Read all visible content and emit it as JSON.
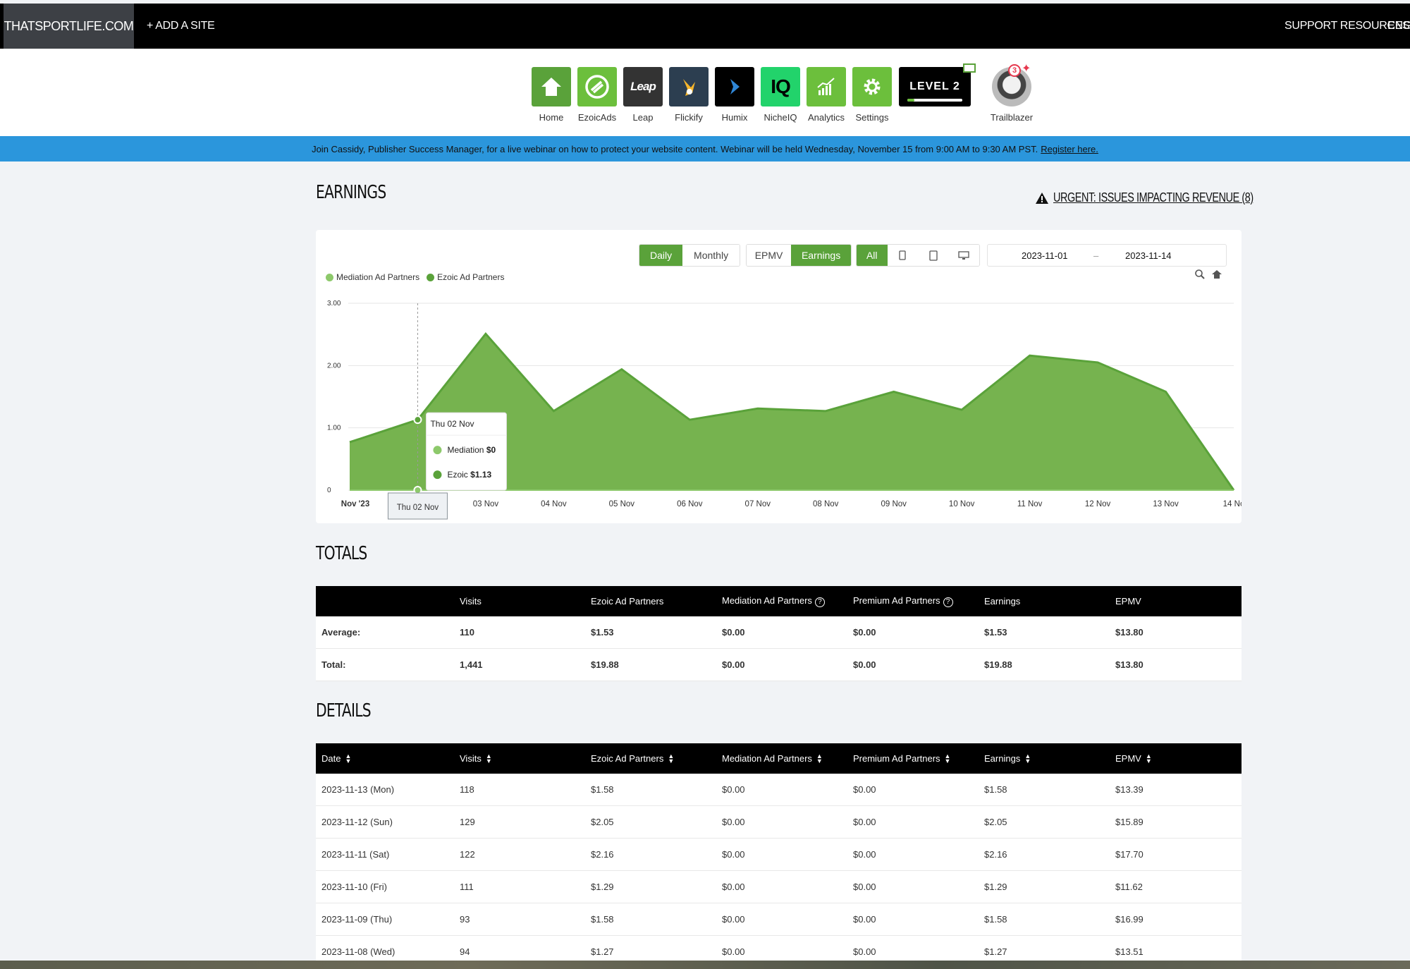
{
  "topbar": {
    "site": "THATSPORTLIFE.COM",
    "add_site": "+ ADD A SITE",
    "support": "SUPPORT RESOURCES",
    "language": "ENGLI"
  },
  "apps": [
    {
      "label": "Home",
      "icon": "home-icon",
      "color": "#5aa23a"
    },
    {
      "label": "EzoicAds",
      "icon": "ezoicads-icon",
      "color": "#6cbf3c"
    },
    {
      "label": "Leap",
      "icon": "leap-icon",
      "color": "#333333"
    },
    {
      "label": "Flickify",
      "icon": "flickify-icon",
      "color": "#2c3e50"
    },
    {
      "label": "Humix",
      "icon": "humix-icon",
      "color": "#000000"
    },
    {
      "label": "NicheIQ",
      "icon": "nicheiq-icon",
      "color": "#22d36b"
    },
    {
      "label": "Analytics",
      "icon": "analytics-icon",
      "color": "#6cbf3c"
    },
    {
      "label": "Settings",
      "icon": "gear-icon",
      "color": "#6cbf3c"
    }
  ],
  "level": {
    "text": "LEVEL 2"
  },
  "trailblazer": {
    "label": "Trailblazer",
    "badge": "3"
  },
  "banner": {
    "text": "Join Cassidy, Publisher Success Manager, for a live webinar on how to protect your website content. Webinar will be held Wednesday, November 15 from 9:00 AM to 9:30 AM PST.",
    "link": "Register here."
  },
  "earnings": {
    "title": "EARNINGS",
    "urgent": "URGENT: ISSUES IMPACTING REVENUE (8)",
    "period_buttons": [
      "Daily",
      "Monthly"
    ],
    "metric_buttons": [
      "EPMV",
      "Earnings"
    ],
    "device_all": "All",
    "date_from": "2023-11-01",
    "date_sep": "–",
    "date_to": "2023-11-14",
    "tooltip": {
      "date": "Thu 02 Nov",
      "mediation_label": "Mediation",
      "mediation_value": "$0",
      "ezoic_label": "Ezoic",
      "ezoic_value": "$1.13"
    },
    "crosshair_label": "Thu 02 Nov"
  },
  "chart_data": {
    "type": "area",
    "title": "",
    "xlabel": "",
    "ylabel": "",
    "x": [
      "Nov '23",
      "Thu 02 Nov",
      "03 Nov",
      "04 Nov",
      "05 Nov",
      "06 Nov",
      "07 Nov",
      "08 Nov",
      "09 Nov",
      "10 Nov",
      "11 Nov",
      "12 Nov",
      "13 Nov",
      "14 No"
    ],
    "ylim": [
      0,
      3
    ],
    "yticks": [
      "0",
      "1.00",
      "2.00",
      "3.00"
    ],
    "series": [
      {
        "name": "Mediation Ad Partners",
        "color": "#8dc96b",
        "values": [
          0,
          0,
          0,
          0,
          0,
          0,
          0,
          0,
          0,
          0,
          0,
          0,
          0,
          0
        ]
      },
      {
        "name": "Ezoic Ad Partners",
        "color": "#5aa23a",
        "values": [
          0.77,
          1.13,
          2.51,
          1.27,
          1.94,
          1.13,
          1.31,
          1.27,
          1.58,
          1.29,
          2.16,
          2.05,
          1.58,
          0.0
        ]
      }
    ],
    "grid": true,
    "legend": "top-left"
  },
  "totals": {
    "title": "TOTALS",
    "headers": [
      "",
      "Visits",
      "Ezoic Ad Partners",
      "Mediation Ad Partners",
      "Premium Ad Partners",
      "Earnings",
      "EPMV"
    ],
    "rows": [
      [
        "Average:",
        "110",
        "$1.53",
        "$0.00",
        "$0.00",
        "$1.53",
        "$13.80"
      ],
      [
        "Total:",
        "1,441",
        "$19.88",
        "$0.00",
        "$0.00",
        "$19.88",
        "$13.80"
      ]
    ]
  },
  "details": {
    "title": "DETAILS",
    "headers": [
      "Date",
      "Visits",
      "Ezoic Ad Partners",
      "Mediation Ad Partners",
      "Premium Ad Partners",
      "Earnings",
      "EPMV"
    ],
    "rows": [
      [
        "2023-11-13 (Mon)",
        "118",
        "$1.58",
        "$0.00",
        "$0.00",
        "$1.58",
        "$13.39"
      ],
      [
        "2023-11-12 (Sun)",
        "129",
        "$2.05",
        "$0.00",
        "$0.00",
        "$2.05",
        "$15.89"
      ],
      [
        "2023-11-11 (Sat)",
        "122",
        "$2.16",
        "$0.00",
        "$0.00",
        "$2.16",
        "$17.70"
      ],
      [
        "2023-11-10 (Fri)",
        "111",
        "$1.29",
        "$0.00",
        "$0.00",
        "$1.29",
        "$11.62"
      ],
      [
        "2023-11-09 (Thu)",
        "93",
        "$1.58",
        "$0.00",
        "$0.00",
        "$1.58",
        "$16.99"
      ],
      [
        "2023-11-08 (Wed)",
        "94",
        "$1.27",
        "$0.00",
        "$0.00",
        "$1.27",
        "$13.51"
      ]
    ]
  }
}
